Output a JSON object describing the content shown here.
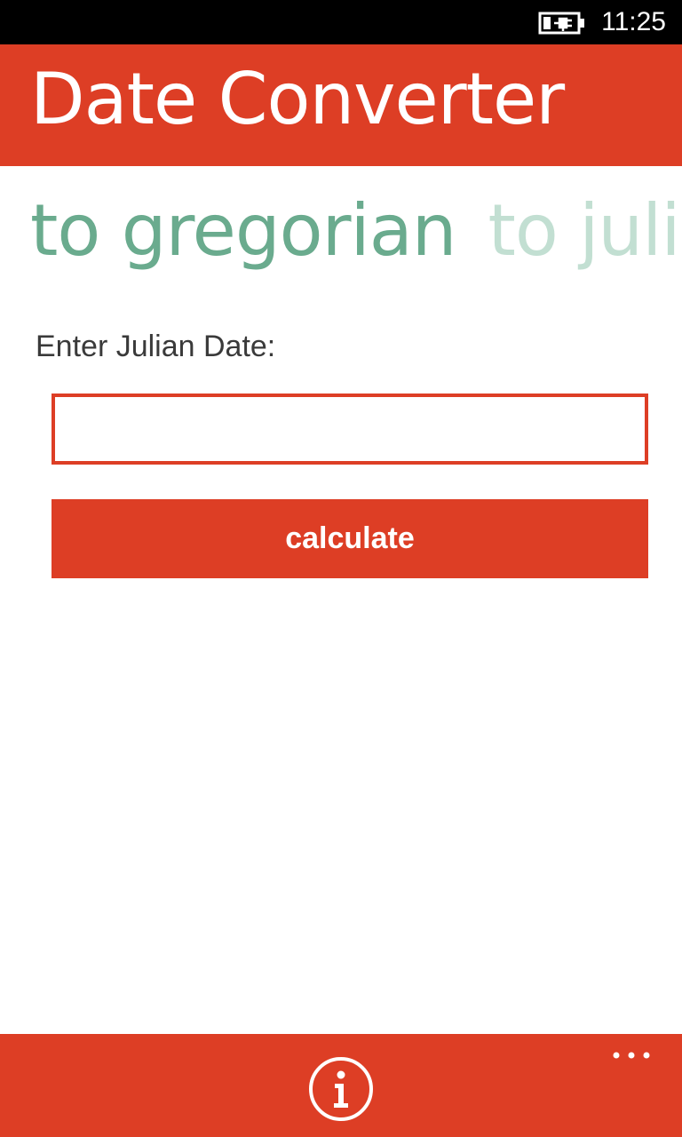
{
  "status_bar": {
    "time": "11:25",
    "battery_icon": "battery-charging-icon"
  },
  "header": {
    "title": "Date Converter"
  },
  "pivot": {
    "tabs": [
      {
        "label": "to gregorian",
        "active": true
      },
      {
        "label": "to julian",
        "active": false
      }
    ]
  },
  "form": {
    "label": "Enter Julian Date:",
    "input_value": "",
    "button_label": "calculate"
  },
  "app_bar": {
    "info_icon": "info-icon",
    "more_icon": "more-ellipsis-icon"
  },
  "colors": {
    "accent": "#dd3e25",
    "pivot_active": "#6aab8e",
    "pivot_inactive": "#c2dfd2",
    "status_bar": "#000000"
  }
}
